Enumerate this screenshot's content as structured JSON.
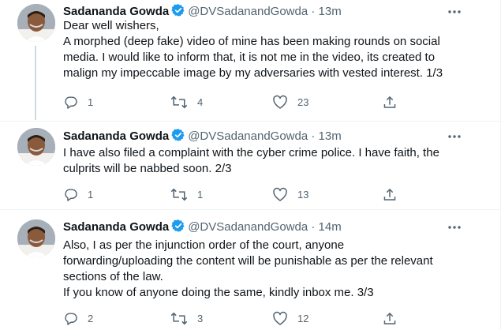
{
  "thread": {
    "tweets": [
      {
        "display_name": "Sadananda Gowda",
        "handle": "@DVSadanandGowda",
        "separator": "·",
        "time": "13m",
        "lines": [
          "Dear well wishers,",
          "A morphed (deep fake) video of mine has been making rounds on social",
          "media. I would like to inform that, it is not me in the video, its created to",
          "malign my impeccable image by my adversaries with vested interest. 1/3"
        ],
        "replies": "1",
        "retweets": "4",
        "likes": "23"
      },
      {
        "display_name": "Sadananda Gowda",
        "handle": "@DVSadanandGowda",
        "separator": "·",
        "time": "13m",
        "lines": [
          "I have also filed a complaint with the cyber crime police. I have faith, the",
          "culprits will be nabbed soon. 2/3"
        ],
        "replies": "1",
        "retweets": "1",
        "likes": "13"
      },
      {
        "display_name": "Sadananda Gowda",
        "handle": "@DVSadanandGowda",
        "separator": "·",
        "time": "14m",
        "lines": [
          "Also, I as per the injunction order of the court, anyone",
          "forwarding/uploading the content will be punishable as per the relevant",
          "sections of the law.",
          "If you know of anyone doing the same, kindly inbox me. 3/3"
        ],
        "replies": "2",
        "retweets": "3",
        "likes": "12"
      }
    ]
  },
  "icons": {
    "verified": "verified-badge-icon",
    "more": "more-horizontal-icon",
    "reply": "reply-icon",
    "retweet": "retweet-icon",
    "like": "heart-icon",
    "share": "share-icon"
  },
  "colors": {
    "text": "#0f1419",
    "secondary": "#536471",
    "verified": "#1d9bf0",
    "divider": "#eff3f4",
    "thread_line": "#cfd9de"
  }
}
